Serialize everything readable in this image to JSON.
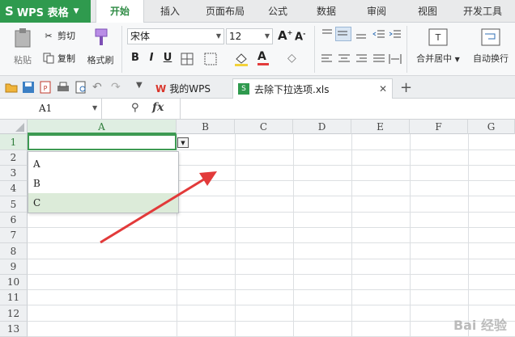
{
  "app": {
    "brand": "WPS 表格",
    "menu_tabs": [
      "开始",
      "插入",
      "页面布局",
      "公式",
      "数据",
      "审阅",
      "视图",
      "开发工具"
    ],
    "active_tab": "开始"
  },
  "ribbon": {
    "paste_label": "粘贴",
    "cut_label": "剪切",
    "copy_label": "复制",
    "format_painter_label": "格式刷",
    "font_name": "宋体",
    "font_size": "12",
    "merge_center_label": "合并居中",
    "wrap_text_label": "自动换行"
  },
  "doc_tabs": {
    "home_tab": "我的WPS",
    "file_tab": "去除下拉选项.xls"
  },
  "formula_bar": {
    "name_box": "A1",
    "fx_label": "fx"
  },
  "grid": {
    "columns": [
      "A",
      "B",
      "C",
      "D",
      "E",
      "F",
      "G"
    ],
    "rows": [
      "1",
      "2",
      "3",
      "4",
      "5",
      "6",
      "7",
      "8",
      "9",
      "10",
      "11",
      "12",
      "13"
    ],
    "selected_cell": "A1"
  },
  "dropdown": {
    "options": [
      "A",
      "B",
      "C"
    ],
    "highlighted": "C"
  },
  "colors": {
    "accent_green": "#2f9a4e",
    "annotation_arrow": "#e23a3a"
  },
  "watermark": "Bai 经验"
}
